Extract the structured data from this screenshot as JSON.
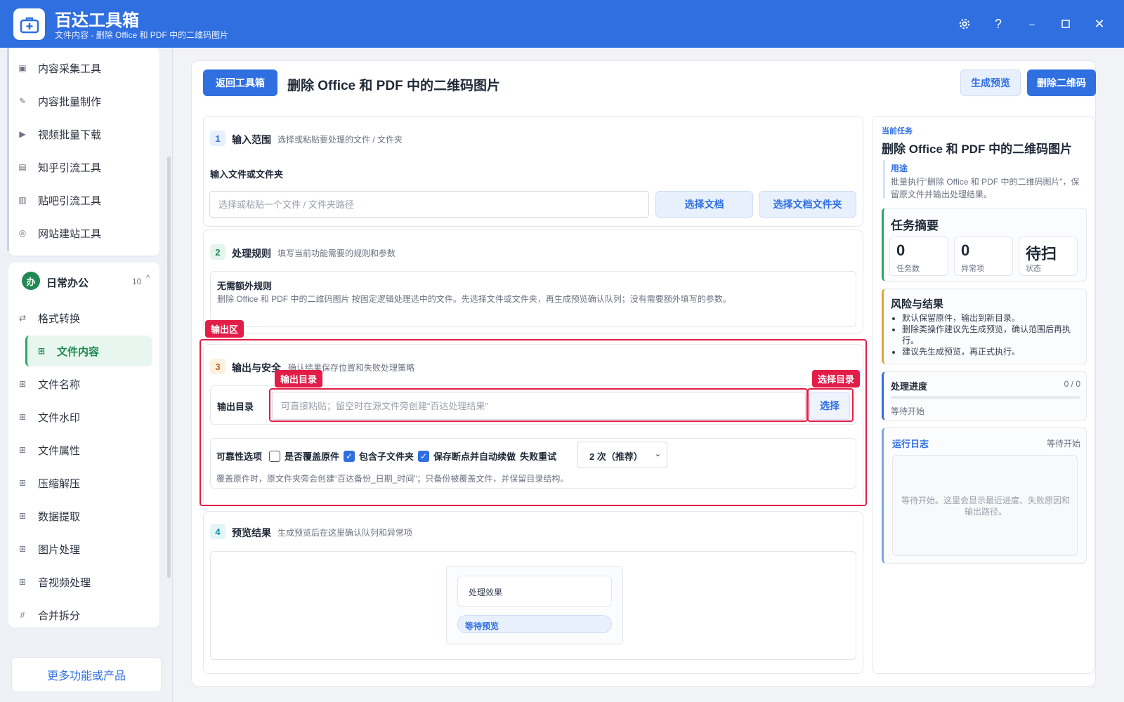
{
  "app": {
    "title": "百达工具箱",
    "subtitle": "文件内容 - 删除 Office 和 PDF 中的二维码图片"
  },
  "sidebar": {
    "top_items": [
      {
        "label": "内容采集工具",
        "icon": "doc-icon"
      },
      {
        "label": "内容批量制作",
        "icon": "pen-icon"
      },
      {
        "label": "视频批量下载",
        "icon": "video-icon"
      },
      {
        "label": "知乎引流工具",
        "icon": "zhihu-icon"
      },
      {
        "label": "贴吧引流工具",
        "icon": "tieba-icon"
      },
      {
        "label": "网站建站工具",
        "icon": "web-icon"
      }
    ],
    "group": {
      "badge": "办",
      "label": "日常办公",
      "count": "10"
    },
    "group_items": [
      {
        "label": "格式转换"
      },
      {
        "label": "文件内容"
      },
      {
        "label": "文件名称"
      },
      {
        "label": "文件水印"
      },
      {
        "label": "文件属性"
      },
      {
        "label": "压缩解压"
      },
      {
        "label": "数据提取"
      },
      {
        "label": "图片处理"
      },
      {
        "label": "音视频处理"
      },
      {
        "label": "合并拆分"
      }
    ],
    "more_link": "更多功能或产品"
  },
  "header": {
    "back_button": "返回工具箱",
    "title": "删除 Office 和 PDF 中的二维码图片",
    "preview_button": "生成预览",
    "run_button": "删除二维码"
  },
  "step1": {
    "num": "1",
    "title": "输入范围",
    "desc": "选择或粘贴要处理的文件 / 文件夹",
    "field_label": "输入文件或文件夹",
    "placeholder": "选择或粘贴一个文件 / 文件夹路径",
    "choose_doc": "选择文档",
    "choose_folder": "选择文档文件夹"
  },
  "step2": {
    "num": "2",
    "title": "处理规则",
    "desc": "填写当前功能需要的规则和参数",
    "rule_title": "无需额外规则",
    "rule_desc": "删除 Office 和 PDF 中的二维码图片 按固定逻辑处理选中的文件。先选择文件或文件夹，再生成预览确认队列；没有需要额外填写的参数。"
  },
  "step3": {
    "num": "3",
    "title": "输出与安全",
    "desc": "确认结果保存位置和失败处理策略",
    "output_label": "输出目录",
    "output_placeholder": "可直接粘贴；留空时在源文件旁创建“百达处理结果”",
    "choose_button": "选择",
    "reliability_label": "可靠性选项",
    "overwrite_label": "是否覆盖原件",
    "overwrite_checked": false,
    "subfolder_label": "包含子文件夹",
    "subfolder_checked": true,
    "resume_label": "保存断点并自动续做",
    "resume_checked": true,
    "retry_label": "失败重试",
    "retry_value": "2 次（推荐）",
    "note": "覆盖原件时，原文件夹旁会创建“百达备份_日期_时间”；只备份被覆盖文件，并保留目录结构。"
  },
  "step4": {
    "num": "4",
    "title": "预览结果",
    "desc": "生成预览后在这里确认队列和异常项",
    "effect_label": "处理效果",
    "waiting_badge": "等待预览"
  },
  "annotations": {
    "output_area": "输出区",
    "output_dir": "输出目录",
    "choose_dir": "选择目录"
  },
  "right": {
    "current_task_label": "当前任务",
    "task_title": "删除 Office 和 PDF 中的二维码图片",
    "usage_label": "用途",
    "usage_text": "批量执行“删除 Office 和 PDF 中的二维码图片”，保留原文件并输出处理结果。",
    "summary_title": "任务摘要",
    "stats": [
      {
        "value": "0",
        "label": "任务数"
      },
      {
        "value": "0",
        "label": "异常项"
      },
      {
        "value": "待扫",
        "label": "状态"
      }
    ],
    "risk_title": "风险与结果",
    "risk_items": [
      "默认保留原件，输出到新目录。",
      "删除类操作建议先生成预览，确认范围后再执行。",
      "建议先生成预览，再正式执行。"
    ],
    "progress_title": "处理进度",
    "progress_count": "0 / 0",
    "progress_value": 0,
    "progress_status": "等待开始",
    "log_title": "运行日志",
    "log_status": "等待开始",
    "log_placeholder": "等待开始。这里会显示最近进度、失败原因和输出路径。"
  },
  "colors": {
    "brand": "#2f6fe0",
    "active_green": "#2ea766",
    "annotation_red": "#e11d48"
  }
}
